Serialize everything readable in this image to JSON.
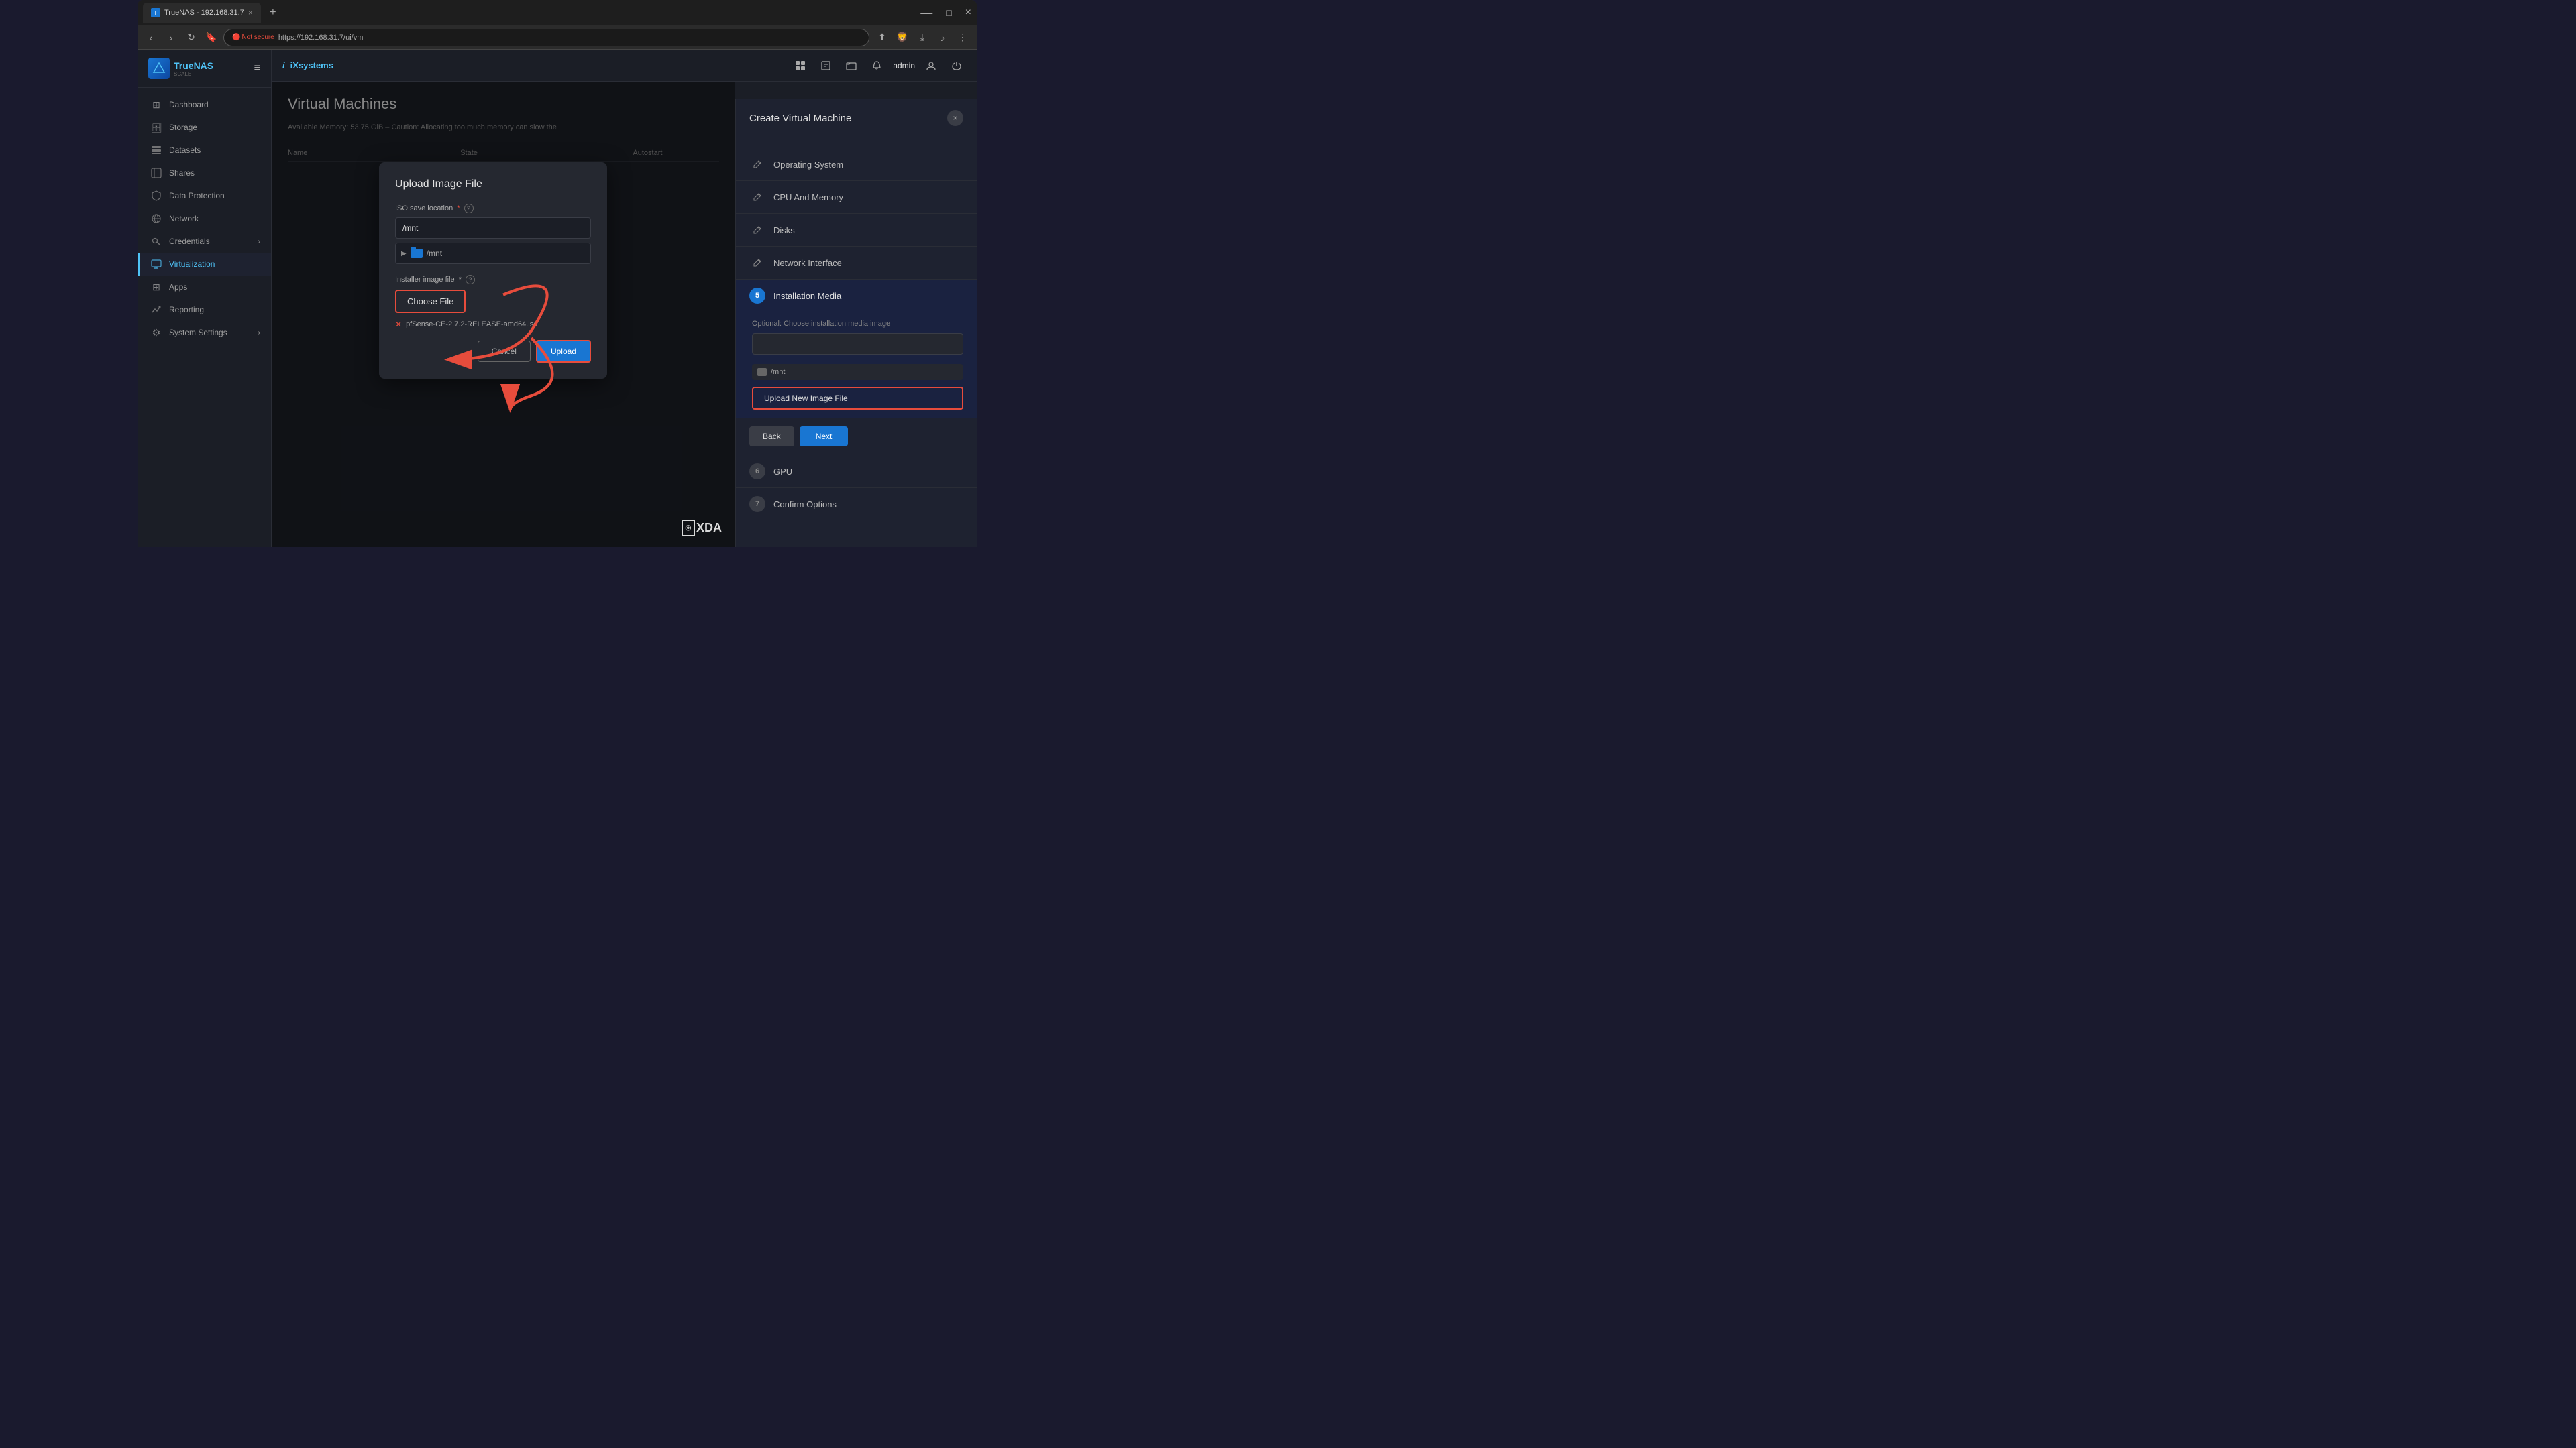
{
  "browser": {
    "tab_title": "TrueNAS - 192.168.31.7",
    "tab_close": "×",
    "tab_new": "+",
    "address_bar": {
      "not_secure_label": "Not secure",
      "url": "https://192.168.31.7/ui/vm"
    },
    "window_controls": {
      "minimize": "—",
      "maximize": "□",
      "close": "×"
    }
  },
  "header": {
    "brand": "iXsystems",
    "hamburger": "≡",
    "admin_label": "admin"
  },
  "sidebar": {
    "logo_text": "TrueNAS",
    "logo_subtext": "SCALE",
    "items": [
      {
        "id": "dashboard",
        "label": "Dashboard",
        "icon": "⊞"
      },
      {
        "id": "storage",
        "label": "Storage",
        "icon": "🗄"
      },
      {
        "id": "datasets",
        "label": "Datasets",
        "icon": "📊"
      },
      {
        "id": "shares",
        "label": "Shares",
        "icon": "📁"
      },
      {
        "id": "data-protection",
        "label": "Data Protection",
        "icon": "🛡"
      },
      {
        "id": "network",
        "label": "Network",
        "icon": "🌐"
      },
      {
        "id": "credentials",
        "label": "Credentials",
        "icon": "🔑",
        "has_arrow": true
      },
      {
        "id": "virtualization",
        "label": "Virtualization",
        "icon": "💻",
        "active": true
      },
      {
        "id": "apps",
        "label": "Apps",
        "icon": "⊞"
      },
      {
        "id": "reporting",
        "label": "Reporting",
        "icon": "📈"
      },
      {
        "id": "system-settings",
        "label": "System Settings",
        "icon": "⚙",
        "has_arrow": true
      }
    ]
  },
  "main": {
    "page_title": "Virtual Machines",
    "available_memory": "Available Memory: 53.75 GiB – Caution: Allocating too much memory can slow the",
    "table": {
      "columns": [
        "Name",
        "State",
        "Autostart"
      ],
      "rows": []
    }
  },
  "upload_dialog": {
    "title": "Upload Image File",
    "iso_save_label": "ISO save location",
    "iso_save_placeholder": "/mnt",
    "folder_label": "/mnt",
    "installer_label": "Installer image file",
    "choose_file_label": "Choose File",
    "selected_file": "pfSense-CE-2.7.2-RELEASE-amd64.iso",
    "cancel_label": "Cancel",
    "upload_label": "Upload"
  },
  "wizard": {
    "title": "Create Virtual Machine",
    "close_icon": "×",
    "steps": [
      {
        "number": "",
        "label": "Operating System",
        "icon": "✏",
        "type": "icon"
      },
      {
        "number": "",
        "label": "CPU And Memory",
        "icon": "✏",
        "type": "icon"
      },
      {
        "number": "",
        "label": "Disks",
        "icon": "✏",
        "type": "icon"
      },
      {
        "number": "",
        "label": "Network Interface",
        "icon": "✏",
        "type": "icon"
      },
      {
        "number": "5",
        "label": "Installation Media",
        "type": "number",
        "active": true
      },
      {
        "number": "6",
        "label": "GPU",
        "type": "number"
      },
      {
        "number": "7",
        "label": "Confirm Options",
        "type": "number"
      }
    ],
    "installation_media": {
      "optional_label": "Optional: Choose installation media image",
      "folder_label": "/mnt"
    },
    "upload_new_label": "Upload New Image File",
    "back_label": "Back",
    "next_label": "Next"
  },
  "xda_watermark": "⌾XDA"
}
